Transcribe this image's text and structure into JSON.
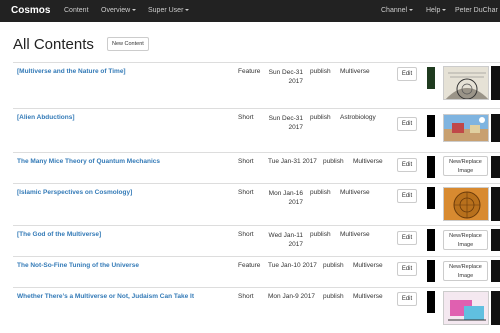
{
  "navbar": {
    "brand": "Cosmos",
    "content": "Content",
    "overview": "Overview",
    "super_user": "Super User",
    "channel": "Channel",
    "help": "Help",
    "user": "Peter DuChar"
  },
  "page": {
    "title": "All Contents",
    "new_content_label": "New Content"
  },
  "rows": [
    {
      "title": "[Multiverse and the Nature of Time]",
      "type": "Feature",
      "date": "Sun Dec-31 2017",
      "status": "publish",
      "category": "Multiverse",
      "edit": "Edit",
      "chip_color": "#1f3b1f",
      "thumb": "engraving"
    },
    {
      "title": "[Alien Abductions]",
      "type": "Short",
      "date": "Sun Dec-31 2017",
      "status": "publish",
      "category": "Astrobiology",
      "edit": "Edit",
      "chip_color": "#000000",
      "thumb": "landscape"
    },
    {
      "title": "The Many Mice Theory of Quantum Mechanics",
      "type": "Short",
      "date": "Tue Jan-31 2017",
      "status": "publish",
      "category": "Multiverse",
      "edit": "Edit",
      "chip_color": "#000000",
      "replace": "New/Replace Image"
    },
    {
      "title": "[Islamic Perspectives on Cosmology]",
      "type": "Short",
      "date": "Mon Jan-16 2017",
      "status": "publish",
      "category": "Multiverse",
      "edit": "Edit",
      "chip_color": "#000000",
      "thumb": "astrolabe"
    },
    {
      "title": "[The God of the Multiverse]",
      "type": "Short",
      "date": "Wed Jan-11 2017",
      "status": "publish",
      "category": "Multiverse",
      "edit": "Edit",
      "chip_color": "#000000",
      "replace": "New/Replace Image"
    },
    {
      "title": "The Not-So-Fine Tuning of the Universe",
      "type": "Feature",
      "date": "Tue Jan-10 2017",
      "status": "publish",
      "category": "Multiverse",
      "edit": "Edit",
      "chip_color": "#000000",
      "replace": "New/Replace Image"
    },
    {
      "title": "Whether There’s a Multiverse or Not, Judaism Can Take It",
      "type": "Short",
      "date": "Mon Jan-9 2017",
      "status": "publish",
      "category": "Multiverse",
      "edit": "Edit",
      "chip_color": "#000000",
      "thumb": "cartoon"
    }
  ]
}
